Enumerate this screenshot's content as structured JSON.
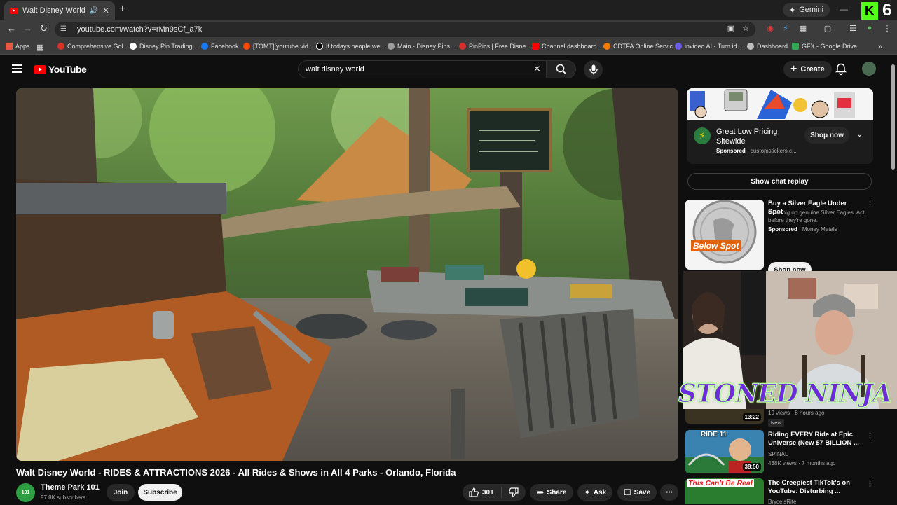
{
  "browser": {
    "tab_title": "Walt Disney World - RIDES",
    "gemini_label": "Gemini",
    "k_logo": "K",
    "tab_count": "6",
    "url": "youtube.com/watch?v=rMn9sCf_a7k"
  },
  "bookmarks": [
    {
      "label": "Apps",
      "color": "#e25b45"
    },
    {
      "label": "Comprehensive Gol...",
      "color": "#d93025"
    },
    {
      "label": "Disney Pin Trading...",
      "color": "#ffffff"
    },
    {
      "label": "Facebook",
      "color": "#1877f2"
    },
    {
      "label": "[TOMT][youtube vid...",
      "color": "#ff4500"
    },
    {
      "label": "If todays people we...",
      "color": "#000000"
    },
    {
      "label": "Main - Disney Pins...",
      "color": "#9e9e9e"
    },
    {
      "label": "PinPics | Free Disne...",
      "color": "#d32f2f"
    },
    {
      "label": "Channel dashboard...",
      "color": "#ff0000"
    },
    {
      "label": "CDTFA Online Servic...",
      "color": "#f57c00"
    },
    {
      "label": "invideo AI - Turn id...",
      "color": "#6c5ce7"
    },
    {
      "label": "Dashboard",
      "color": "#bdbdbd"
    },
    {
      "label": "GFX - Google Drive",
      "color": "#34a853"
    }
  ],
  "youtube": {
    "logo_text": "YouTube",
    "search_value": "walt disney world",
    "create_label": "Create"
  },
  "video": {
    "title": "Walt Disney World - RIDES & ATTRACTIONS 2026 - All Rides & Shows in All 4 Parks - Orlando, Florida",
    "channel_name": "Theme Park 101",
    "channel_avatar_text": "101",
    "subscribers": "97.8K subscribers",
    "join_label": "Join",
    "subscribe_label": "Subscribe",
    "like_count": "301",
    "share_label": "Share",
    "ask_label": "Ask",
    "save_label": "Save"
  },
  "ad": {
    "title": "Great Low Pricing Sitewide",
    "sponsored_label": "Sponsored",
    "domain": "customstickers.c...",
    "cta": "Shop now"
  },
  "chat_replay_label": "Show chat replay",
  "recommendations": [
    {
      "title": "Buy a Silver Eagle Under Spot",
      "desc": "Save big on genuine Silver Eagles. Act before they're gone.",
      "sponsored_label": "Sponsored",
      "advertiser": "Money Metals",
      "thumb_label": "Below Spot",
      "cta": "Shop now"
    },
    {
      "views": "19 views",
      "age": "8 hours ago",
      "duration": "13:22",
      "badge": "New"
    },
    {
      "title": "Riding EVERY Ride at Epic Universe (New $7 BILLION ...",
      "channel": "SPINAL",
      "views": "438K views",
      "age": "7 months ago",
      "duration": "38:50",
      "thumb_label": "RIDE 11"
    },
    {
      "title": "The Creepiest TikTok's on YouTube: Disturbing ...",
      "channel": "BrycelsRite",
      "thumb_label": "This Can't Be Real"
    }
  ],
  "overlay": {
    "text": "STONED NINJA"
  },
  "colors": {
    "yt_red": "#ff0000",
    "background": "#0f0f0f",
    "kick_green": "#53fc18",
    "overlay_purple": "#6d2bd9"
  }
}
